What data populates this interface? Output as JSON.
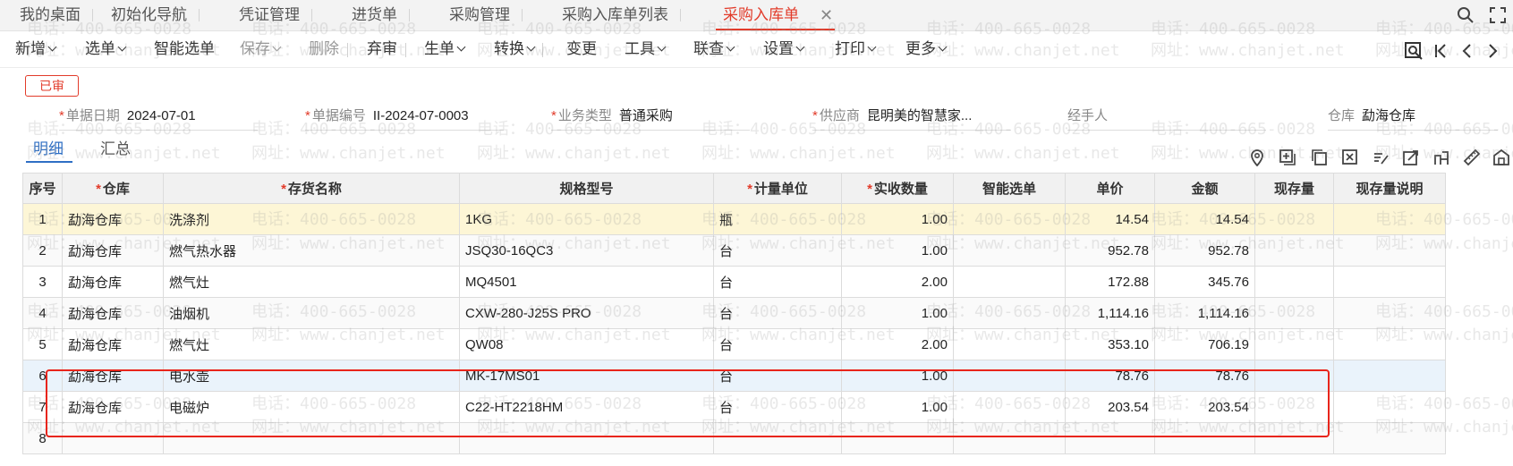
{
  "tabs": [
    {
      "label": "我的桌面"
    },
    {
      "label": "初始化导航"
    },
    {
      "label": "凭证管理"
    },
    {
      "label": "进货单"
    },
    {
      "label": "采购管理"
    },
    {
      "label": "采购入库单列表"
    },
    {
      "label": "采购入库单",
      "active": true
    }
  ],
  "tab_close": "✕",
  "toolbar": [
    {
      "label": "新增",
      "dropdown": true
    },
    {
      "label": "选单",
      "dropdown": true
    },
    {
      "label": "智能选单"
    },
    {
      "label": "保存",
      "dropdown": true,
      "disabled": true
    },
    {
      "label": "删除",
      "disabled": true
    },
    {
      "label": "弃审"
    },
    {
      "label": "生单",
      "dropdown": true
    },
    {
      "label": "转换",
      "dropdown": true
    },
    {
      "label": "变更"
    },
    {
      "label": "工具",
      "dropdown": true
    },
    {
      "label": "联查",
      "dropdown": true
    },
    {
      "label": "设置",
      "dropdown": true
    },
    {
      "label": "打印",
      "dropdown": true
    },
    {
      "label": "更多",
      "dropdown": true
    }
  ],
  "status": "已审",
  "header": {
    "date": {
      "label": "单据日期",
      "value": "2024-07-01",
      "required": true
    },
    "code": {
      "label": "单据编号",
      "value": "II-2024-07-0003",
      "required": true
    },
    "biztype": {
      "label": "业务类型",
      "value": "普通采购",
      "required": true
    },
    "supplier": {
      "label": "供应商",
      "value": "昆明美的智慧家...",
      "required": true
    },
    "handler": {
      "label": "经手人",
      "value": ""
    },
    "warehouse": {
      "label": "仓库",
      "value": "勐海仓库"
    }
  },
  "subtabs": [
    "明细",
    "汇总"
  ],
  "columns": [
    {
      "label": "序号"
    },
    {
      "label": "仓库",
      "required": true
    },
    {
      "label": "存货名称",
      "required": true
    },
    {
      "label": "规格型号"
    },
    {
      "label": "计量单位",
      "required": true
    },
    {
      "label": "实收数量",
      "required": true
    },
    {
      "label": "智能选单"
    },
    {
      "label": "单价"
    },
    {
      "label": "金额"
    },
    {
      "label": "现存量"
    },
    {
      "label": "现存量说明"
    }
  ],
  "rows": [
    {
      "no": "1",
      "wh": "勐海仓库",
      "name": "洗涤剂",
      "spec": "1KG",
      "unit": "瓶",
      "qty": "1.00",
      "smart": "",
      "price": "14.54",
      "amount": "14.54",
      "stock": "",
      "stock_note": ""
    },
    {
      "no": "2",
      "wh": "勐海仓库",
      "name": "燃气热水器",
      "spec": "JSQ30-16QC3",
      "unit": "台",
      "qty": "1.00",
      "smart": "",
      "price": "952.78",
      "amount": "952.78",
      "stock": "",
      "stock_note": ""
    },
    {
      "no": "3",
      "wh": "勐海仓库",
      "name": "燃气灶",
      "spec": "MQ4501",
      "unit": "台",
      "qty": "2.00",
      "smart": "",
      "price": "172.88",
      "amount": "345.76",
      "stock": "",
      "stock_note": ""
    },
    {
      "no": "4",
      "wh": "勐海仓库",
      "name": "油烟机",
      "spec": "CXW-280-J25S PRO",
      "unit": "台",
      "qty": "1.00",
      "smart": "",
      "price": "1,114.16",
      "amount": "1,114.16",
      "stock": "",
      "stock_note": ""
    },
    {
      "no": "5",
      "wh": "勐海仓库",
      "name": "燃气灶",
      "spec": "QW08",
      "unit": "台",
      "qty": "2.00",
      "smart": "",
      "price": "353.10",
      "amount": "706.19",
      "stock": "",
      "stock_note": ""
    },
    {
      "no": "6",
      "wh": "勐海仓库",
      "name": "电水壶",
      "spec": "MK-17MS01",
      "unit": "台",
      "qty": "1.00",
      "smart": "",
      "price": "78.76",
      "amount": "78.76",
      "stock": "",
      "stock_note": ""
    },
    {
      "no": "7",
      "wh": "勐海仓库",
      "name": "电磁炉",
      "spec": "C22-HT2218HM",
      "unit": "台",
      "qty": "1.00",
      "smart": "",
      "price": "203.54",
      "amount": "203.54",
      "stock": "",
      "stock_note": ""
    },
    {
      "no": "8",
      "wh": "",
      "name": "",
      "spec": "",
      "unit": "",
      "qty": "",
      "smart": "",
      "price": "",
      "amount": "",
      "stock": "",
      "stock_note": ""
    }
  ],
  "watermark": {
    "phone": "电话：400-665-0028",
    "site": "网址：www.chanjet.net"
  },
  "colors": {
    "accent_red": "#e23b2a",
    "link_blue": "#2f6fc4",
    "selected_row": "#fdf6d6",
    "highlight_row": "#eaf3fb"
  }
}
